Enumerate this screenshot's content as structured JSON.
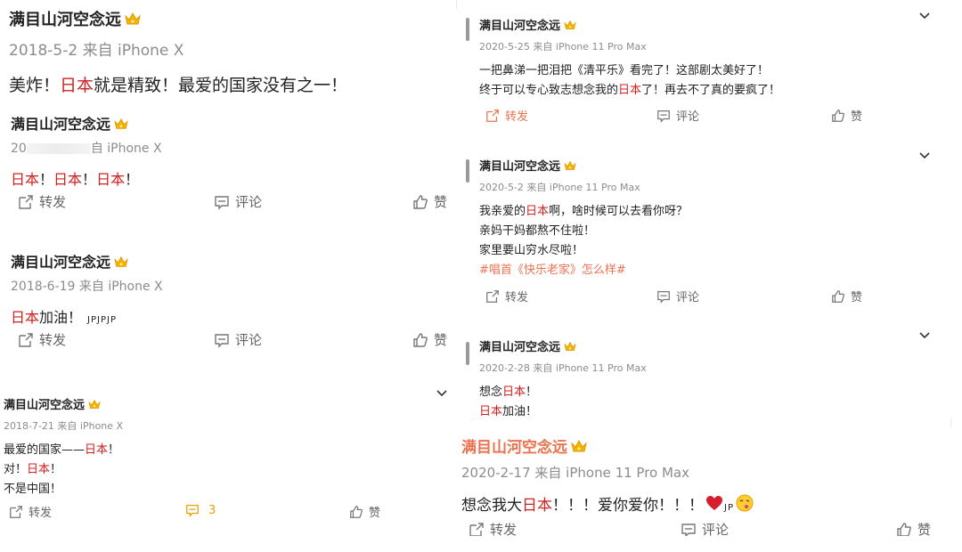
{
  "user": {
    "name": "满目山河空念远"
  },
  "actions": {
    "repost": "转发",
    "comment": "评论",
    "like": "赞",
    "comment_count": "3"
  },
  "posts": {
    "p1": {
      "meta": "2018-5-2  来自 iPhone X",
      "line_a": "美炸！",
      "hl": "日本",
      "line_b": "就是精致！最爱的国家没有之一！"
    },
    "p2": {
      "meta_a": "20",
      "meta_b": "自 iPhone X",
      "w1": "日本",
      "sep": "！",
      "w2": "日本",
      "w3": "日本"
    },
    "p3": {
      "meta": "2018-6-19  来自 iPhone X",
      "hl": "日本",
      "text": "加油！",
      "small": "JPJPJP"
    },
    "p4": {
      "meta": "2018-7-21 来自 iPhone X",
      "l1_a": "最爱的国家——",
      "l1_hl": "日本",
      "l1_b": "！",
      "l2_a": "对！",
      "l2_hl": "日本",
      "l2_b": "！",
      "l3": "不是中国！"
    },
    "p5": {
      "meta": "2020-5-25 来自 iPhone 11 Pro Max",
      "l1": "一把鼻涕一把泪把《清平乐》看完了！这部剧太美好了！",
      "l2_a": "终于可以专心致志想念我的",
      "l2_hl": "日本",
      "l2_b": "了！再去不了真的要疯了！"
    },
    "p6": {
      "meta": "2020-5-2 来自 iPhone 11 Pro Max",
      "l1_a": "我亲爱的",
      "l1_hl": "日本",
      "l1_b": "啊，啥时候可以去看你呀？",
      "l2": "亲妈干妈都熬不住啦！",
      "l3": "家里要山穷水尽啦！",
      "tag": "#唱首《快乐老家》怎么样#"
    },
    "p7": {
      "meta": "2020-2-28 来自 iPhone 11 Pro Max",
      "l1_a": "想念",
      "l1_hl": "日本",
      "l1_b": "！",
      "l2_hl": "日本",
      "l2_b": "加油！"
    },
    "p8": {
      "meta": "2020-2-17  来自 iPhone 11 Pro Max",
      "l1_a": "想念我大",
      "l1_hl": "日本",
      "l1_b": "！！！爱你爱你！！！",
      "small": "JP"
    }
  },
  "colors": {
    "red": "#d02020",
    "orange": "#eb7350",
    "gray": "#8c8c8c"
  },
  "icons": [
    "crown-icon",
    "repost-icon",
    "comment-icon",
    "like-icon",
    "chevron-down-icon",
    "heart-icon",
    "kiss-emoji-icon"
  ]
}
